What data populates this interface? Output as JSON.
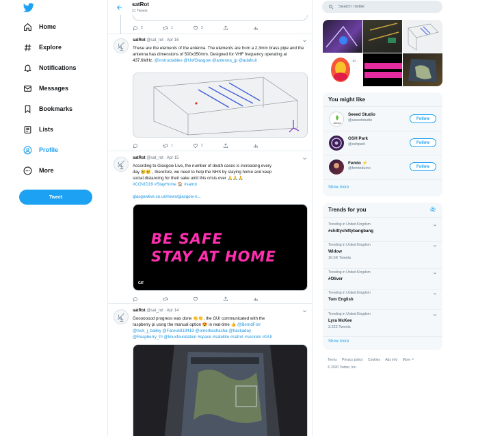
{
  "nav": {
    "items": [
      {
        "label": "Home",
        "icon": "home-icon"
      },
      {
        "label": "Explore",
        "icon": "hashtag-icon"
      },
      {
        "label": "Notifications",
        "icon": "bell-icon"
      },
      {
        "label": "Messages",
        "icon": "mail-icon"
      },
      {
        "label": "Bookmarks",
        "icon": "bookmark-icon"
      },
      {
        "label": "Lists",
        "icon": "list-icon"
      },
      {
        "label": "Profile",
        "icon": "profile-icon"
      },
      {
        "label": "More",
        "icon": "more-icon"
      }
    ],
    "tweet_label": "Tweet",
    "accent": "#1da1f2"
  },
  "header": {
    "title": "satRot",
    "subtitle": "21 Tweets"
  },
  "top_partial_tweet": {
    "replies": "2",
    "retweets": "1",
    "likes": "2"
  },
  "tweets": [
    {
      "name": "satRot",
      "handle": "@sat_rot",
      "date": "Apr 16",
      "text": "These are the elements of the antenna. The elements are from a 2.3mm brass pipe and the antenna has  dimensions of 500x350mm. Designed for VHF frequency operating at 437.6MHz.",
      "link1": "@instructables",
      "link2": "@UofGlasgow",
      "link3": "@antenna_jp",
      "link4": "@adafruit",
      "replies": "",
      "retweets": "1",
      "likes": "2"
    },
    {
      "name": "satRot",
      "handle": "@sat_rot",
      "date": "Apr 15",
      "text_a": "According to Glasgow Live, the number of death cases is increasing every",
      "text_b": "day 😢😢 , therefore, we need to help the NHS by staying home and keep",
      "text_c": "social distancing for their sake until this crisis over 🙏🙏🙏",
      "hashtags": "#COVID19 #StayHome 🏠 #satrot",
      "url": "glasgowlive.co.uk/news/glasgow-n...",
      "gif_line1": "BE SAFE",
      "gif_line2": "STAY AT HOME",
      "gif_badge": "GIF"
    },
    {
      "name": "satRot",
      "handle": "@sat_rot",
      "date": "Apr 14",
      "text_a": "Goooooood progress was done 👏👏, the GUI communicated with the",
      "text_b": "raspberry pi using the manual option 😍 in real-time 👍",
      "mention1": "@BerndForr",
      "line3": "@nick_j_bailey @Farouk819419 @omerbashasha @hackaday",
      "line4": "@Raspberry_Pi @linuxfoundation #space #satellite #satrot #sockets #GUI"
    }
  ],
  "search": {
    "placeholder": "Search Twitter"
  },
  "who_to_follow": {
    "title": "You might like",
    "accounts": [
      {
        "name": "Seeed Studio",
        "handle": "@seeedstudio",
        "button": "Follow"
      },
      {
        "name": "OSH Park",
        "handle": "@oshpark",
        "button": "Follow"
      },
      {
        "name": "Femto ⚡",
        "handle": "@femtoduino",
        "button": "Follow"
      }
    ],
    "show_more": "Show more"
  },
  "trends": {
    "title": "Trends for you",
    "items": [
      {
        "context": "Trending in United Kingdom",
        "name": "#chittychittybangbang",
        "count": ""
      },
      {
        "context": "Trending in United Kingdom",
        "name": "Widow",
        "count": "16.6K Tweets"
      },
      {
        "context": "Trending in United Kingdom",
        "name": "#Oliver",
        "count": ""
      },
      {
        "context": "Trending in United Kingdom",
        "name": "Tom English",
        "count": ""
      },
      {
        "context": "Trending in United Kingdom",
        "name": "Lyra McKee",
        "count": "3,222 Tweets"
      }
    ],
    "show_more": "Show more"
  },
  "footer": {
    "links": [
      "Terms",
      "Privacy policy",
      "Cookies",
      "Ads info",
      "More"
    ],
    "copyright": "© 2020 Twitter, Inc."
  },
  "colors": {
    "accent": "#1da1f2",
    "link": "#1b95e0",
    "muted": "#657786",
    "gif_bg": "#000000",
    "gif_text": "#ff2fb0"
  }
}
